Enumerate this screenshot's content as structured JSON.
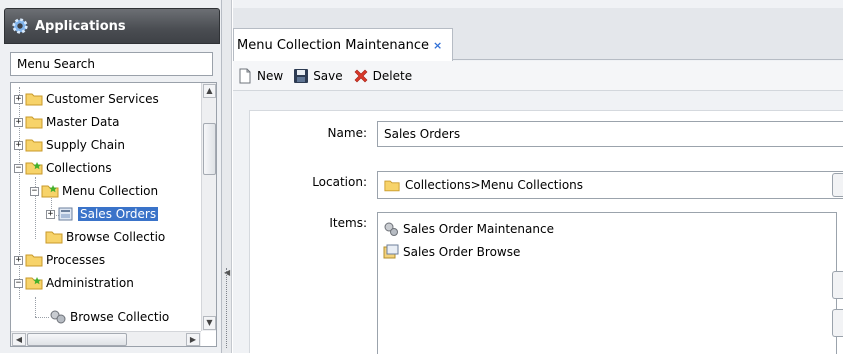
{
  "left_panel": {
    "title": "Applications",
    "search": {
      "value": "Menu Search",
      "placeholder": "Menu Search"
    },
    "tree": [
      {
        "label": "Customer Services",
        "expander": "+"
      },
      {
        "label": "Master Data",
        "expander": "+"
      },
      {
        "label": "Supply Chain",
        "expander": "+"
      },
      {
        "label": "Collections",
        "expander": "−"
      },
      {
        "label": "Menu Collection",
        "expander": "−"
      },
      {
        "label": "Sales Orders",
        "expander": "+"
      },
      {
        "label": "Browse Collectio"
      },
      {
        "label": "Processes",
        "expander": "+"
      },
      {
        "label": "Administration",
        "expander": "−"
      },
      {
        "label": "Browse Collectio"
      }
    ]
  },
  "tab": {
    "label": "Menu Collection Maintenance",
    "close": "×"
  },
  "toolbar": {
    "new_label": "New",
    "save_label": "Save",
    "delete_label": "Delete"
  },
  "form": {
    "name_label": "Name:",
    "name_value": "Sales Orders",
    "location_label": "Location:",
    "location_value": "Collections>Menu Collections",
    "items_label": "Items:",
    "items": [
      {
        "label": "Sales Order Maintenance",
        "icon": "gears-icon"
      },
      {
        "label": "Sales Order Browse",
        "icon": "browse-icon"
      }
    ]
  },
  "colors": {
    "header_dark": "#4a4d52",
    "selection": "#3a73c9",
    "folder_yellow": "#f3c84b",
    "delete_red": "#d9382a",
    "tab_close_blue": "#2f6fd6"
  }
}
